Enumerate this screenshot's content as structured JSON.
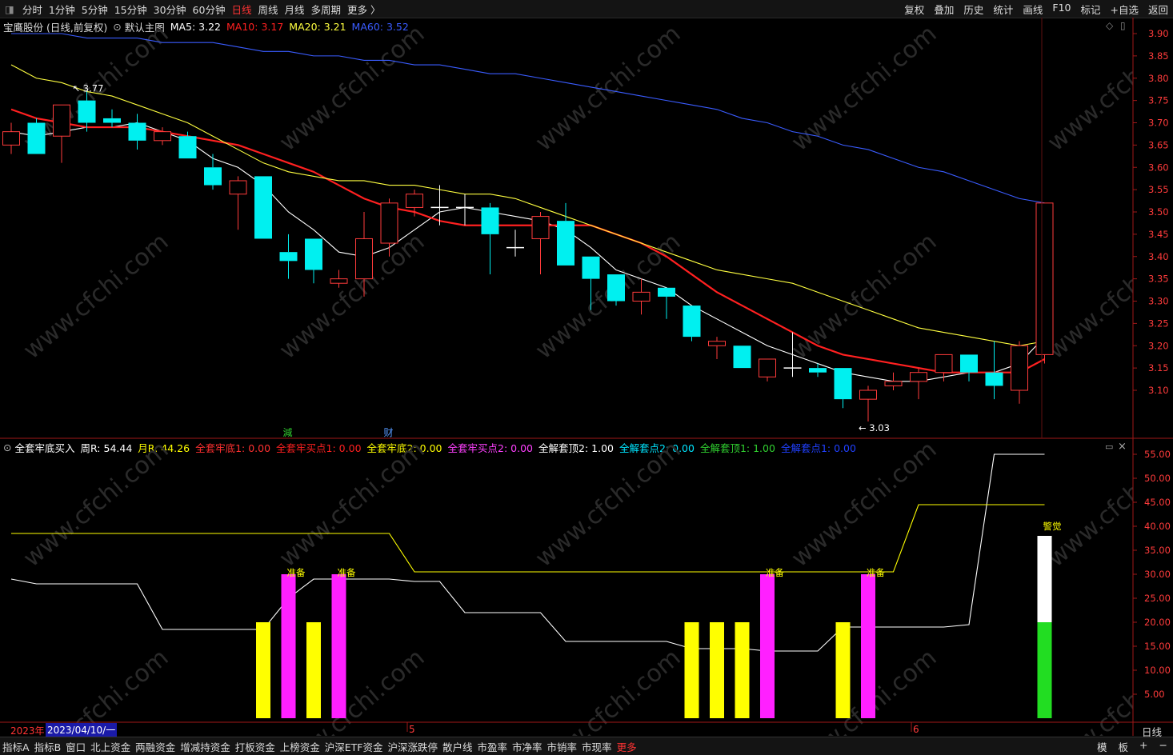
{
  "toolbar": {
    "periods": [
      {
        "label": "分时",
        "active": false
      },
      {
        "label": "1分钟",
        "active": false
      },
      {
        "label": "5分钟",
        "active": false
      },
      {
        "label": "15分钟",
        "active": false
      },
      {
        "label": "30分钟",
        "active": false
      },
      {
        "label": "60分钟",
        "active": false
      },
      {
        "label": "日线",
        "active": true
      },
      {
        "label": "周线",
        "active": false
      },
      {
        "label": "月线",
        "active": false
      },
      {
        "label": "多周期",
        "active": false
      },
      {
        "label": "更多 〉",
        "active": false
      }
    ],
    "actions": [
      "复权",
      "叠加",
      "历史",
      "统计",
      "画线",
      "F10",
      "标记",
      "+自选",
      "返回"
    ]
  },
  "main_legend": {
    "stock": "宝鹰股份 (日线,前复权)",
    "template": "默认主图",
    "ma": [
      {
        "label": "MA5: 3.22",
        "color": "#ffffff"
      },
      {
        "label": "MA10: 3.17",
        "color": "#ff2020"
      },
      {
        "label": "MA20: 3.21",
        "color": "#ffff40"
      },
      {
        "label": "MA60: 3.52",
        "color": "#3a5cff"
      }
    ]
  },
  "sub_legend": {
    "items": [
      {
        "label": "全套牢底买入",
        "color": "#ffffff"
      },
      {
        "label": "周R: 54.44",
        "color": "#ffffff"
      },
      {
        "label": "月R: 44.26",
        "color": "#ffff00"
      },
      {
        "label": "全套牢底1: 0.00",
        "color": "#ff3030"
      },
      {
        "label": "全套牢买点1: 0.00",
        "color": "#ff2020"
      },
      {
        "label": "全套牢底2: 0.00",
        "color": "#ffff00"
      },
      {
        "label": "全套牢买点2: 0.00",
        "color": "#ff40ff"
      },
      {
        "label": "全解套顶2: 1.00",
        "color": "#ffffff"
      },
      {
        "label": "全解套点2: 0.00",
        "color": "#00e5ff"
      },
      {
        "label": "全解套顶1: 1.00",
        "color": "#30d030"
      },
      {
        "label": "全解套点1: 0.00",
        "color": "#2040ff"
      }
    ]
  },
  "chart_data": [
    {
      "type": "candlestick",
      "title": "宝鹰股份 (日线,前复权)",
      "ylim": [
        3.03,
        3.92
      ],
      "yticks": [
        "3.90",
        "3.85",
        "3.80",
        "3.75",
        "3.70",
        "3.65",
        "3.60",
        "3.55",
        "3.50",
        "3.45",
        "3.40",
        "3.35",
        "3.30",
        "3.25",
        "3.20",
        "3.15",
        "3.10"
      ],
      "candles": [
        {
          "o": 3.65,
          "h": 3.7,
          "l": 3.63,
          "c": 3.68
        },
        {
          "o": 3.7,
          "h": 3.71,
          "l": 3.63,
          "c": 3.63
        },
        {
          "o": 3.67,
          "h": 3.74,
          "l": 3.61,
          "c": 3.74
        },
        {
          "o": 3.75,
          "h": 3.77,
          "l": 3.68,
          "c": 3.7
        },
        {
          "o": 3.71,
          "h": 3.73,
          "l": 3.69,
          "c": 3.7
        },
        {
          "o": 3.7,
          "h": 3.72,
          "l": 3.64,
          "c": 3.66
        },
        {
          "o": 3.66,
          "h": 3.69,
          "l": 3.65,
          "c": 3.68
        },
        {
          "o": 3.67,
          "h": 3.68,
          "l": 3.62,
          "c": 3.62
        },
        {
          "o": 3.6,
          "h": 3.63,
          "l": 3.55,
          "c": 3.56
        },
        {
          "o": 3.54,
          "h": 3.58,
          "l": 3.46,
          "c": 3.57
        },
        {
          "o": 3.58,
          "h": 3.58,
          "l": 3.44,
          "c": 3.44
        },
        {
          "o": 3.41,
          "h": 3.45,
          "l": 3.35,
          "c": 3.39
        },
        {
          "o": 3.44,
          "h": 3.44,
          "l": 3.34,
          "c": 3.37
        },
        {
          "o": 3.34,
          "h": 3.37,
          "l": 3.33,
          "c": 3.35
        },
        {
          "o": 3.35,
          "h": 3.5,
          "l": 3.31,
          "c": 3.44
        },
        {
          "o": 3.43,
          "h": 3.53,
          "l": 3.4,
          "c": 3.52
        },
        {
          "o": 3.51,
          "h": 3.55,
          "l": 3.49,
          "c": 3.54
        },
        {
          "o": 3.51,
          "h": 3.56,
          "l": 3.47,
          "c": 3.51
        },
        {
          "o": 3.51,
          "h": 3.54,
          "l": 3.47,
          "c": 3.51
        },
        {
          "o": 3.51,
          "h": 3.52,
          "l": 3.36,
          "c": 3.45
        },
        {
          "o": 3.42,
          "h": 3.46,
          "l": 3.4,
          "c": 3.42
        },
        {
          "o": 3.44,
          "h": 3.5,
          "l": 3.36,
          "c": 3.49
        },
        {
          "o": 3.48,
          "h": 3.52,
          "l": 3.38,
          "c": 3.38
        },
        {
          "o": 3.4,
          "h": 3.4,
          "l": 3.28,
          "c": 3.35
        },
        {
          "o": 3.36,
          "h": 3.36,
          "l": 3.29,
          "c": 3.3
        },
        {
          "o": 3.3,
          "h": 3.35,
          "l": 3.27,
          "c": 3.32
        },
        {
          "o": 3.33,
          "h": 3.33,
          "l": 3.26,
          "c": 3.31
        },
        {
          "o": 3.29,
          "h": 3.29,
          "l": 3.21,
          "c": 3.22
        },
        {
          "o": 3.2,
          "h": 3.22,
          "l": 3.17,
          "c": 3.21
        },
        {
          "o": 3.2,
          "h": 3.2,
          "l": 3.15,
          "c": 3.15
        },
        {
          "o": 3.13,
          "h": 3.17,
          "l": 3.12,
          "c": 3.17
        },
        {
          "o": 3.15,
          "h": 3.23,
          "l": 3.13,
          "c": 3.15
        },
        {
          "o": 3.15,
          "h": 3.16,
          "l": 3.13,
          "c": 3.14
        },
        {
          "o": 3.15,
          "h": 3.15,
          "l": 3.06,
          "c": 3.08
        },
        {
          "o": 3.08,
          "h": 3.11,
          "l": 3.03,
          "c": 3.1
        },
        {
          "o": 3.11,
          "h": 3.14,
          "l": 3.1,
          "c": 3.12
        },
        {
          "o": 3.12,
          "h": 3.15,
          "l": 3.08,
          "c": 3.14
        },
        {
          "o": 3.14,
          "h": 3.18,
          "l": 3.12,
          "c": 3.18
        },
        {
          "o": 3.18,
          "h": 3.18,
          "l": 3.12,
          "c": 3.14
        },
        {
          "o": 3.14,
          "h": 3.21,
          "l": 3.08,
          "c": 3.11
        },
        {
          "o": 3.1,
          "h": 3.21,
          "l": 3.07,
          "c": 3.2
        },
        {
          "o": 3.18,
          "h": 3.52,
          "l": 3.16,
          "c": 3.52
        }
      ],
      "series": [
        {
          "name": "MA5",
          "color": "#ffffff",
          "values": [
            3.68,
            3.67,
            3.68,
            3.69,
            3.69,
            3.7,
            3.68,
            3.66,
            3.62,
            3.6,
            3.56,
            3.5,
            3.46,
            3.41,
            3.4,
            3.42,
            3.46,
            3.5,
            3.51,
            3.5,
            3.49,
            3.48,
            3.46,
            3.42,
            3.37,
            3.35,
            3.33,
            3.29,
            3.26,
            3.23,
            3.2,
            3.18,
            3.16,
            3.14,
            3.13,
            3.12,
            3.12,
            3.13,
            3.14,
            3.14,
            3.16,
            3.22
          ]
        },
        {
          "name": "MA10",
          "color": "#ff2020",
          "values": [
            3.73,
            3.71,
            3.7,
            3.69,
            3.69,
            3.69,
            3.68,
            3.67,
            3.66,
            3.65,
            3.63,
            3.61,
            3.59,
            3.56,
            3.53,
            3.51,
            3.5,
            3.48,
            3.47,
            3.47,
            3.47,
            3.47,
            3.47,
            3.47,
            3.45,
            3.43,
            3.4,
            3.36,
            3.32,
            3.29,
            3.26,
            3.23,
            3.2,
            3.18,
            3.17,
            3.16,
            3.15,
            3.14,
            3.14,
            3.14,
            3.14,
            3.17
          ]
        },
        {
          "name": "MA20",
          "color": "#ffff40",
          "values": [
            3.83,
            3.8,
            3.79,
            3.77,
            3.76,
            3.74,
            3.72,
            3.7,
            3.67,
            3.64,
            3.61,
            3.59,
            3.58,
            3.57,
            3.57,
            3.56,
            3.56,
            3.55,
            3.54,
            3.54,
            3.53,
            3.51,
            3.49,
            3.47,
            3.45,
            3.43,
            3.41,
            3.39,
            3.37,
            3.36,
            3.35,
            3.34,
            3.32,
            3.3,
            3.28,
            3.26,
            3.24,
            3.23,
            3.22,
            3.21,
            3.2,
            3.21
          ]
        },
        {
          "name": "MA60",
          "color": "#3a5cff",
          "values": [
            3.9,
            3.9,
            3.9,
            3.89,
            3.89,
            3.89,
            3.88,
            3.88,
            3.88,
            3.87,
            3.86,
            3.86,
            3.85,
            3.85,
            3.84,
            3.84,
            3.83,
            3.83,
            3.82,
            3.81,
            3.81,
            3.8,
            3.79,
            3.78,
            3.77,
            3.76,
            3.75,
            3.74,
            3.73,
            3.71,
            3.7,
            3.68,
            3.67,
            3.65,
            3.64,
            3.62,
            3.6,
            3.59,
            3.57,
            3.55,
            3.53,
            3.52
          ]
        }
      ],
      "annotations": [
        {
          "text": "3.77",
          "index": 3,
          "value": 3.77
        },
        {
          "text": "3.03",
          "index": 34,
          "value": 3.03
        }
      ],
      "markers": [
        {
          "text": "減",
          "index": 11,
          "color": "#30d030"
        },
        {
          "text": "财",
          "index": 15,
          "color": "#5599ff"
        }
      ]
    },
    {
      "type": "bar",
      "title": "全套牢底买入",
      "ylim": [
        0,
        57
      ],
      "yticks": [
        "55.00",
        "50.00",
        "45.00",
        "40.00",
        "35.00",
        "30.00",
        "25.00",
        "20.00",
        "15.00",
        "10.00",
        "5.00"
      ],
      "series": [
        {
          "name": "周R",
          "color": "#ffffff",
          "values": [
            29,
            28,
            28,
            28,
            28,
            28,
            18.5,
            18.5,
            18.5,
            18.5,
            18.5,
            25,
            29,
            29,
            29,
            29,
            28.5,
            28.5,
            22,
            22,
            22,
            22,
            16,
            16,
            16,
            16,
            16,
            14.5,
            14.5,
            14.5,
            14,
            14,
            14,
            19,
            19,
            19,
            19,
            19,
            19.5,
            55,
            55,
            55
          ]
        },
        {
          "name": "月R",
          "color": "#ffff00",
          "values": [
            38.5,
            38.5,
            38.5,
            38.5,
            38.5,
            38.5,
            38.5,
            38.5,
            38.5,
            38.5,
            38.5,
            38.5,
            38.5,
            38.5,
            38.5,
            38.5,
            30.5,
            30.5,
            30.5,
            30.5,
            30.5,
            30.5,
            30.5,
            30.5,
            30.5,
            30.5,
            30.5,
            30.5,
            30.5,
            30.5,
            30.5,
            30.5,
            30.5,
            30.5,
            30.5,
            30.5,
            44.5,
            44.5,
            44.5,
            44.5,
            44.5,
            44.5
          ]
        }
      ],
      "bars": [
        {
          "index": 10,
          "value": 20,
          "color": "#ffff00"
        },
        {
          "index": 11,
          "value": 30,
          "color": "#ff20ff",
          "label": "准备"
        },
        {
          "index": 12,
          "value": 20,
          "color": "#ffff00"
        },
        {
          "index": 13,
          "value": 30,
          "color": "#ff20ff",
          "label": "准备"
        },
        {
          "index": 27,
          "value": 20,
          "color": "#ffff00"
        },
        {
          "index": 28,
          "value": 20,
          "color": "#ffff00"
        },
        {
          "index": 29,
          "value": 20,
          "color": "#ffff00"
        },
        {
          "index": 30,
          "value": 30,
          "color": "#ff20ff",
          "label": "准备"
        },
        {
          "index": 33,
          "value": 20,
          "color": "#ffff00"
        },
        {
          "index": 34,
          "value": 30,
          "color": "#ff20ff",
          "label": "准备"
        }
      ],
      "stacked_bar": {
        "index": 41,
        "green": 20,
        "white": 18,
        "label": "警觉"
      }
    }
  ],
  "date_axis": {
    "year": "2023年",
    "cursor_date": "2023/04/10/一",
    "months": [
      {
        "label": "5",
        "index": 16
      },
      {
        "label": "6",
        "index": 36
      }
    ],
    "period": "日线"
  },
  "bottom_tabs": [
    "指标A",
    "指标B",
    "窗口",
    "北上资金",
    "两融资金",
    "增减持资金",
    "打板资金",
    "上榜资金",
    "沪深ETF资金",
    "沪深涨跌停",
    "散户线",
    "市盈率",
    "市净率",
    "市销率",
    "市现率",
    "更多"
  ],
  "bottom_right": [
    "模",
    "板",
    "+",
    "−"
  ]
}
